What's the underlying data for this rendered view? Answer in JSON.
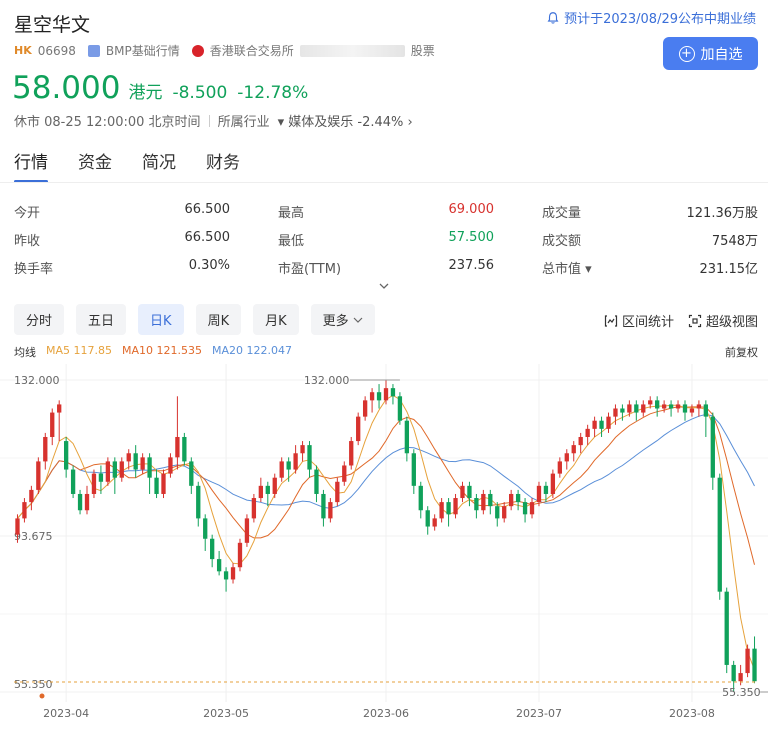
{
  "header": {
    "title": "星空华文",
    "notice": "预计于2023/08/29公布中期业绩",
    "market": "HK",
    "code": "06698",
    "bmp": "BMP基础行情",
    "exchange": "香港联合交易所",
    "exchange_suffix": "股票",
    "add_label": "加自选"
  },
  "quote": {
    "price": "58.000",
    "currency": "港元",
    "change": "-8.500",
    "change_pct": "-12.78%",
    "status": "休市 08-25 12:00:00 北京时间",
    "industry_label": "所属行业",
    "industry": "媒体及娱乐",
    "industry_change": "-2.44%"
  },
  "tabs": [
    "行情",
    "资金",
    "简况",
    "财务"
  ],
  "stats": [
    [
      {
        "label": "今开",
        "value": "66.500"
      },
      {
        "label": "最高",
        "value": "69.000"
      },
      {
        "label": "成交量",
        "value": "121.36万股"
      }
    ],
    [
      {
        "label": "昨收",
        "value": "66.500"
      },
      {
        "label": "最低",
        "value": "57.500"
      },
      {
        "label": "成交额",
        "value": "7548万"
      }
    ],
    [
      {
        "label": "换手率",
        "value": "0.30%"
      },
      {
        "label": "市盈(TTM)",
        "value": "237.56"
      },
      {
        "label": "总市值",
        "value": "231.15亿"
      }
    ]
  ],
  "periods": [
    "分时",
    "五日",
    "日K",
    "周K",
    "月K",
    "更多"
  ],
  "active_period": "日K",
  "tools": {
    "interval": "区间统计",
    "super": "超级视图"
  },
  "ma": {
    "label": "均线",
    "ma5": "MA5 117.85",
    "ma10": "MA10 121.535",
    "ma20": "MA20 122.047",
    "adjust": "前复权"
  },
  "colors": {
    "up": "#d7322e",
    "down": "#10a15a",
    "accent": "#4a7df0",
    "ma5": "#e6a23c",
    "ma10": "#e0692a",
    "ma20": "#5a8fd8"
  },
  "chart_data": {
    "type": "candlestick",
    "y_labels": [
      "132.000",
      "93.675",
      "55.350"
    ],
    "ylim": [
      55.35,
      132.0
    ],
    "high_marker": "132.000",
    "low_marker": "55.350",
    "x_ticks": [
      {
        "label": "2023-04",
        "index": 7
      },
      {
        "label": "2023-05",
        "index": 30
      },
      {
        "label": "2023-06",
        "index": 53
      },
      {
        "label": "2023-07",
        "index": 75
      },
      {
        "label": "2023-08",
        "index": 97
      }
    ],
    "high_index": 55,
    "low_index": 114,
    "candles": [
      [
        94,
        98,
        92,
        99
      ],
      [
        98,
        102,
        97,
        103
      ],
      [
        102,
        105,
        100,
        106
      ],
      [
        105,
        112,
        104,
        113
      ],
      [
        112,
        118,
        110,
        119
      ],
      [
        118,
        124,
        116,
        125
      ],
      [
        124,
        126,
        117,
        127
      ],
      [
        117,
        110,
        108,
        118
      ],
      [
        110,
        104,
        103,
        111
      ],
      [
        104,
        100,
        99,
        105
      ],
      [
        100,
        104,
        99,
        106
      ],
      [
        104,
        109,
        103,
        110
      ],
      [
        109,
        107,
        104,
        111
      ],
      [
        107,
        112,
        106,
        113
      ],
      [
        112,
        108,
        104,
        113
      ],
      [
        108,
        112,
        107,
        113
      ],
      [
        112,
        114,
        110,
        115
      ],
      [
        114,
        110,
        108,
        116
      ],
      [
        110,
        113,
        109,
        114
      ],
      [
        113,
        108,
        104,
        114
      ],
      [
        108,
        104,
        103,
        110
      ],
      [
        104,
        109,
        103,
        110
      ],
      [
        109,
        113,
        108,
        114
      ],
      [
        113,
        118,
        110,
        128
      ],
      [
        118,
        112,
        111,
        119
      ],
      [
        112,
        106,
        104,
        113
      ],
      [
        106,
        98,
        96,
        107
      ],
      [
        98,
        93,
        90,
        99
      ],
      [
        93,
        88,
        86,
        94
      ],
      [
        88,
        85,
        84,
        90
      ],
      [
        85,
        83,
        80,
        86
      ],
      [
        83,
        86,
        82,
        87
      ],
      [
        86,
        92,
        85,
        93
      ],
      [
        92,
        98,
        91,
        99
      ],
      [
        98,
        103,
        97,
        104
      ],
      [
        103,
        106,
        102,
        108
      ],
      [
        106,
        104,
        101,
        107
      ],
      [
        104,
        108,
        103,
        109
      ],
      [
        108,
        112,
        107,
        113
      ],
      [
        112,
        110,
        107,
        113
      ],
      [
        110,
        114,
        109,
        116
      ],
      [
        114,
        116,
        112,
        117
      ],
      [
        116,
        110,
        108,
        117
      ],
      [
        110,
        104,
        102,
        111
      ],
      [
        104,
        98,
        96,
        105
      ],
      [
        98,
        102,
        97,
        103
      ],
      [
        102,
        107,
        101,
        108
      ],
      [
        107,
        111,
        106,
        112
      ],
      [
        111,
        117,
        110,
        118
      ],
      [
        117,
        123,
        116,
        124
      ],
      [
        123,
        127,
        122,
        128
      ],
      [
        127,
        129,
        124,
        130
      ],
      [
        129,
        127,
        125,
        131
      ],
      [
        127,
        130,
        126,
        132
      ],
      [
        130,
        128,
        126,
        131
      ],
      [
        128,
        122,
        121,
        129
      ],
      [
        122,
        114,
        112,
        123
      ],
      [
        114,
        106,
        104,
        115
      ],
      [
        106,
        100,
        98,
        107
      ],
      [
        100,
        96,
        94,
        101
      ],
      [
        96,
        98,
        95,
        99
      ],
      [
        98,
        102,
        97,
        103
      ],
      [
        102,
        99,
        96,
        103
      ],
      [
        99,
        103,
        98,
        104
      ],
      [
        103,
        106,
        102,
        107
      ],
      [
        106,
        103,
        101,
        107
      ],
      [
        103,
        100,
        98,
        104
      ],
      [
        100,
        104,
        99,
        105
      ],
      [
        104,
        101,
        99,
        105
      ],
      [
        101,
        98,
        96,
        102
      ],
      [
        98,
        101,
        97,
        102
      ],
      [
        101,
        104,
        100,
        105
      ],
      [
        104,
        102,
        100,
        105
      ],
      [
        102,
        99,
        97,
        103
      ],
      [
        99,
        102,
        98,
        103
      ],
      [
        102,
        106,
        101,
        107
      ],
      [
        106,
        104,
        102,
        107
      ],
      [
        104,
        109,
        103,
        110
      ],
      [
        109,
        112,
        108,
        113
      ],
      [
        112,
        114,
        110,
        115
      ],
      [
        114,
        116,
        112,
        117
      ],
      [
        116,
        118,
        114,
        119
      ],
      [
        118,
        120,
        116,
        121
      ],
      [
        120,
        122,
        118,
        123
      ],
      [
        122,
        120,
        118,
        123
      ],
      [
        120,
        123,
        119,
        124
      ],
      [
        123,
        125,
        121,
        126
      ],
      [
        125,
        124,
        122,
        126
      ],
      [
        124,
        126,
        123,
        127
      ],
      [
        126,
        124,
        122,
        127
      ],
      [
        124,
        126,
        123,
        127
      ],
      [
        126,
        127,
        125,
        128
      ],
      [
        127,
        125,
        123,
        128
      ],
      [
        125,
        126,
        124,
        127
      ],
      [
        126,
        125,
        123,
        127
      ],
      [
        125,
        126,
        124,
        127
      ],
      [
        126,
        124,
        122,
        127
      ],
      [
        124,
        125,
        123,
        126
      ],
      [
        125,
        126,
        123,
        127
      ],
      [
        126,
        123,
        118,
        127
      ],
      [
        123,
        108,
        105,
        124
      ],
      [
        108,
        80,
        78,
        109
      ],
      [
        80,
        62,
        60,
        81
      ],
      [
        62,
        58,
        55.35,
        63
      ],
      [
        58,
        60,
        57,
        62
      ],
      [
        60,
        66,
        59,
        67
      ],
      [
        66,
        58,
        57.5,
        69
      ]
    ]
  }
}
